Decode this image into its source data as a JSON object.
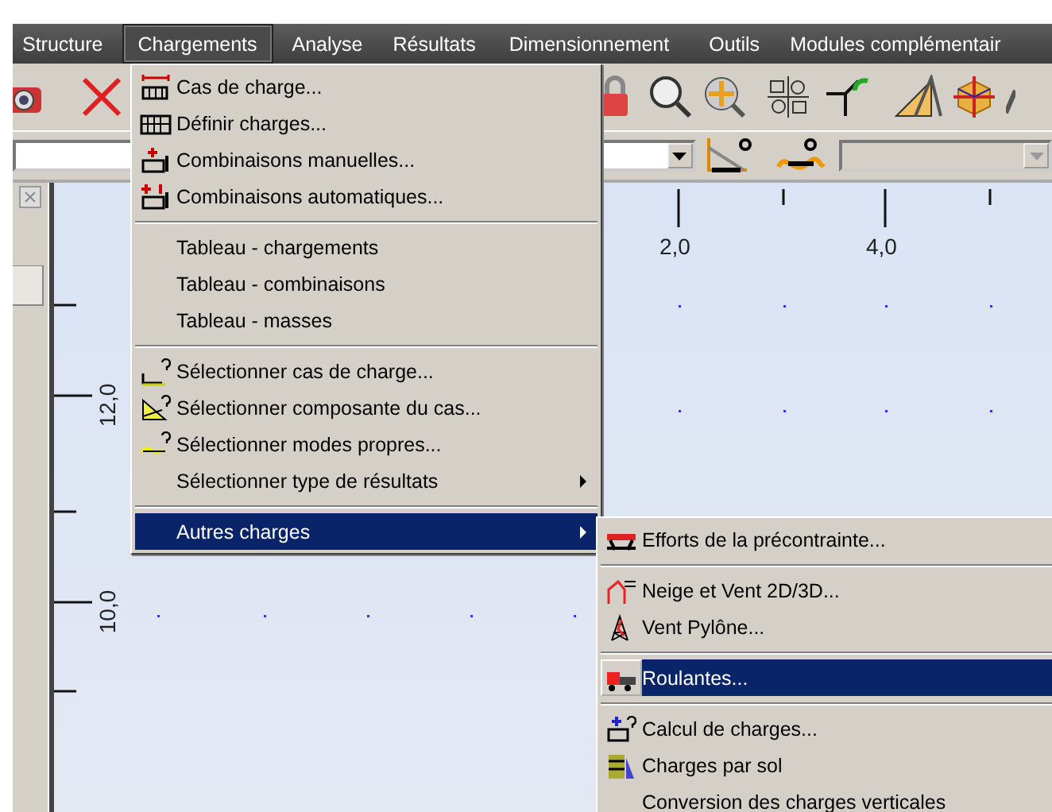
{
  "menu_bar": [
    {
      "label": "Structure",
      "selected": false
    },
    {
      "label": "Chargements",
      "selected": true
    },
    {
      "label": "Analyse",
      "selected": false
    },
    {
      "label": "Résultats",
      "selected": false
    },
    {
      "label": "Dimensionnement",
      "selected": false
    },
    {
      "label": "Outils",
      "selected": false
    },
    {
      "label": "Modules complémentair",
      "selected": false
    }
  ],
  "combo_row": {
    "selection_combo": {
      "disabled": false
    },
    "filter_combo": {
      "disabled": true
    }
  },
  "canvas": {
    "x_labels": [
      "2,0",
      "4,0"
    ],
    "y_labels": [
      "12,0",
      "10,0"
    ]
  },
  "loads_menu": {
    "items": [
      {
        "kind": "command",
        "label": "Cas de charge...",
        "selected": false
      },
      {
        "kind": "command",
        "label": "Définir charges...",
        "selected": false
      },
      {
        "kind": "command",
        "label": "Combinaisons manuelles...",
        "selected": false
      },
      {
        "kind": "command",
        "label": "Combinaisons automatiques...",
        "selected": false
      },
      {
        "kind": "separator"
      },
      {
        "kind": "command",
        "label": "Tableau - chargements",
        "selected": false
      },
      {
        "kind": "command",
        "label": "Tableau - combinaisons",
        "selected": false
      },
      {
        "kind": "command",
        "label": "Tableau - masses",
        "selected": false
      },
      {
        "kind": "separator"
      },
      {
        "kind": "command",
        "label": "Sélectionner cas de charge...",
        "selected": false
      },
      {
        "kind": "command",
        "label": "Sélectionner composante du cas...",
        "selected": false
      },
      {
        "kind": "command",
        "label": "Sélectionner modes propres...",
        "selected": false
      },
      {
        "kind": "submenu",
        "label": "Sélectionner type de résultats",
        "selected": false
      },
      {
        "kind": "separator"
      },
      {
        "kind": "submenu",
        "label": "Autres charges",
        "selected": true
      }
    ]
  },
  "other_loads_submenu": {
    "items": [
      {
        "kind": "command",
        "label": "Efforts de la précontrainte...",
        "selected": false
      },
      {
        "kind": "separator"
      },
      {
        "kind": "command",
        "label": "Neige et Vent 2D/3D...",
        "selected": false
      },
      {
        "kind": "command",
        "label": "Vent Pylône...",
        "selected": false
      },
      {
        "kind": "separator"
      },
      {
        "kind": "command",
        "label": "Roulantes...",
        "selected": true
      },
      {
        "kind": "separator"
      },
      {
        "kind": "command",
        "label": "Calcul de charges...",
        "selected": false
      },
      {
        "kind": "command",
        "label": "Charges par sol",
        "selected": false
      },
      {
        "kind": "command",
        "label": "Conversion des charges verticales",
        "selected": false
      }
    ]
  }
}
